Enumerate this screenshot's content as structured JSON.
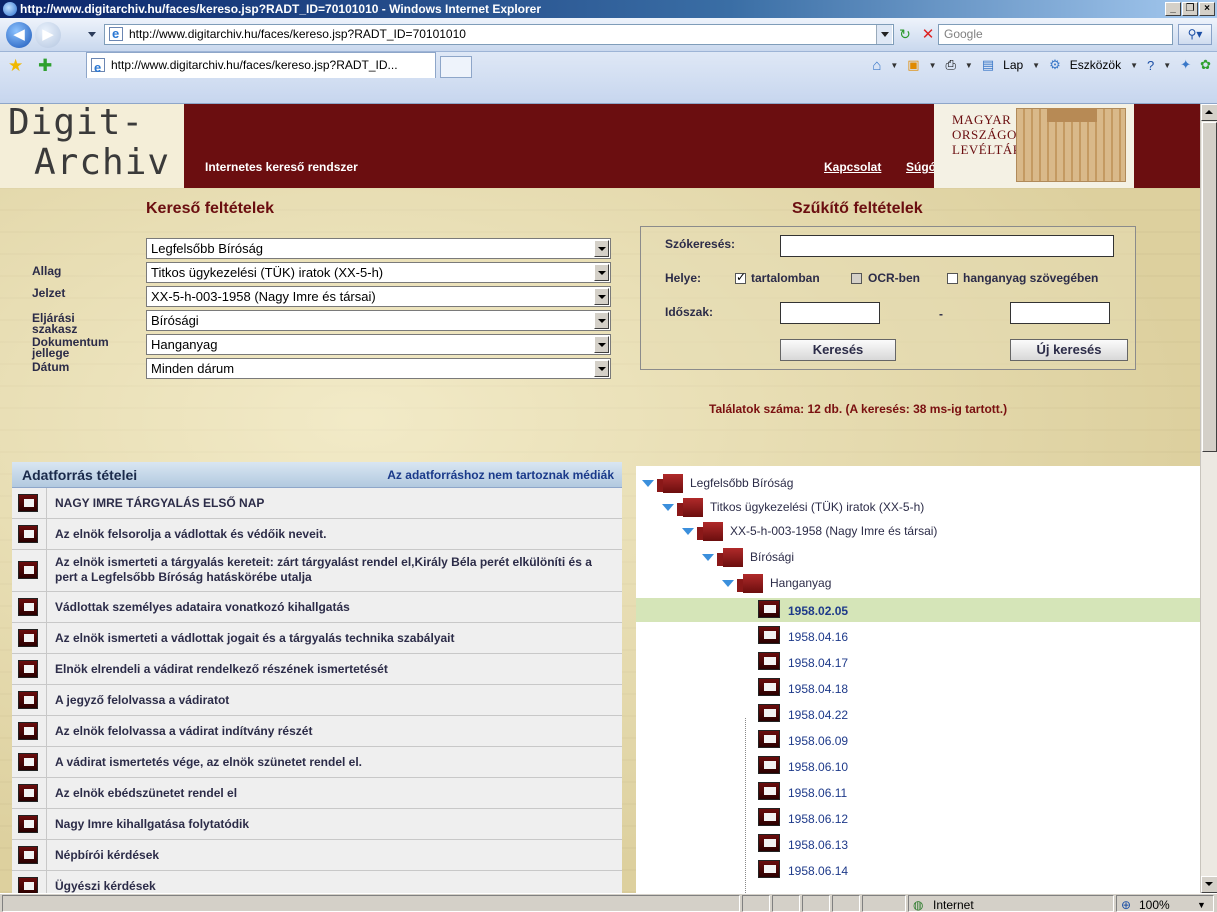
{
  "window": {
    "title": "http://www.digitarchiv.hu/faces/kereso.jsp?RADT_ID=70101010 - Windows Internet Explorer",
    "url": "http://www.digitarchiv.hu/faces/kereso.jsp?RADT_ID=70101010",
    "search_placeholder": "Google",
    "tab_title": "http://www.digitarchiv.hu/faces/kereso.jsp?RADT_ID...",
    "cmd_lap": "Lap",
    "cmd_tools": "Eszközök"
  },
  "header": {
    "logo_line1": "Digit-",
    "logo_line2": "Archiv",
    "subtitle": "Internetes kereső rendszer",
    "link_contact": "Kapcsolat",
    "link_help": "Súgó",
    "mol_line1": "MAGYAR",
    "mol_line2": "ORSZÁGOS",
    "mol_line3": "LEVÉLTÁR"
  },
  "search": {
    "title": "Kereső feltételek",
    "rows": [
      {
        "label": "",
        "value": "Legfelsőbb Bíróság"
      },
      {
        "label": "Allag",
        "value": "Titkos ügykezelési (TÜK) iratok (XX-5-h)"
      },
      {
        "label": "Jelzet",
        "value": "XX-5-h-003-1958 (Nagy Imre és társai)"
      },
      {
        "label": "Eljárási szakasz",
        "value": "Bírósági"
      },
      {
        "label": "Dokumentum jellege",
        "value": "Hanganyag"
      },
      {
        "label": "Dátum",
        "value": "Minden dárum"
      }
    ]
  },
  "filters": {
    "title": "Szűkítő feltételek",
    "keyword_label": "Szókeresés:",
    "keyword_value": "",
    "place_label": "Helye:",
    "opt_content": "tartalomban",
    "opt_ocr": "OCR-ben",
    "opt_audio": "hanganyag szövegében",
    "period_label": "Időszak:",
    "dash": "-",
    "search_button": "Keresés",
    "new_search_button": "Új keresés",
    "results_text": "Találatok száma: 12 db. (A keresés: 38 ms-ig tartott.)"
  },
  "list": {
    "title": "Adatforrás tételei",
    "note": "Az adatforráshoz nem tartoznak médiák",
    "items": [
      "NAGY IMRE TÁRGYALÁS ELSŐ NAP",
      "Az elnök felsorolja a vádlottak és védőik neveit.",
      "Az elnök ismerteti a tárgyalás kereteit: zárt tárgyalást rendel el,Király Béla perét elkülöníti és a pert a Legfelsőbb Bíróság hatáskörébe utalja",
      "Vádlottak személyes adataira vonatkozó kihallgatás",
      "Az elnök ismerteti a vádlottak jogait és a tárgyalás technika szabályait",
      "Elnök elrendeli a vádirat rendelkező részének ismertetését",
      "A jegyző felolvassa a vádiratot",
      "Az elnök felolvassa a vádirat indítvány részét",
      "A vádirat ismertetés vége, az elnök szünetet rendel el.",
      "Az elnök ebédszünetet rendel el",
      "Nagy Imre kihallgatása folytatódik",
      "Népbírói kérdések",
      "Ügyészi kérdések"
    ]
  },
  "tree": {
    "nodes": [
      "Legfelsőbb Bíróság",
      "Titkos ügykezelési (TÜK) iratok (XX-5-h)",
      "XX-5-h-003-1958 (Nagy Imre és társai)",
      "Bírósági",
      "Hanganyag"
    ],
    "dates": [
      "1958.02.05",
      "1958.04.16",
      "1958.04.17",
      "1958.04.18",
      "1958.04.22",
      "1958.06.09",
      "1958.06.10",
      "1958.06.11",
      "1958.06.12",
      "1958.06.13",
      "1958.06.14"
    ],
    "selected": "1958.02.05"
  },
  "status": {
    "zone": "Internet",
    "zoom": "100%"
  }
}
